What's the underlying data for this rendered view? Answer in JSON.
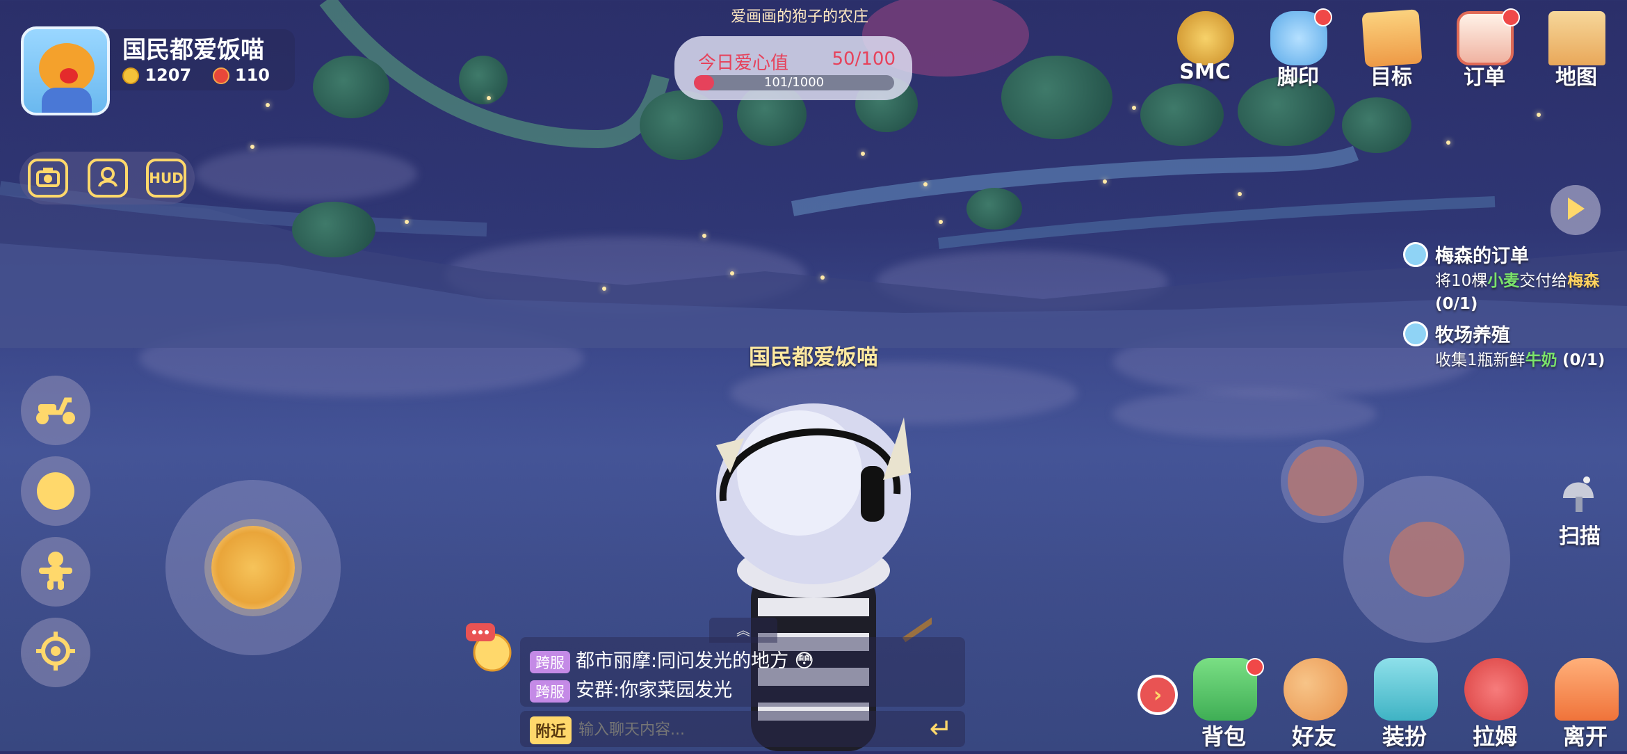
{
  "farm_title": "爱画画的狍子的农庄",
  "player": {
    "name": "国民都爱饭喵",
    "coins": "1207",
    "gems": "110"
  },
  "camera_buttons": [
    {
      "label": ""
    },
    {
      "label": ""
    },
    {
      "label": "HUD"
    }
  ],
  "love": {
    "label": "今日爱心值",
    "value_text": "50/100",
    "progress_text": "101/1000",
    "progress_fraction": 0.101
  },
  "top_menu": [
    {
      "label": "SMC",
      "icon": "smc-badge-icon",
      "color": "#e9a93a",
      "badge": false
    },
    {
      "label": "脚印",
      "icon": "paw-print-icon",
      "color": "#6db7f0",
      "badge": true
    },
    {
      "label": "目标",
      "icon": "target-card-icon",
      "color": "#f2a24a",
      "badge": false
    },
    {
      "label": "订单",
      "icon": "order-clipboard-icon",
      "color": "#ef7f6b",
      "badge": true
    },
    {
      "label": "地图",
      "icon": "castle-map-icon",
      "color": "#f5c36a",
      "badge": false
    }
  ],
  "tasks": [
    {
      "title": "梅森的订单",
      "desc_prefix": "将10棵",
      "desc_item": "小麦",
      "desc_mid": "交付给",
      "desc_target": "梅森",
      "desc_progress": "(0/1)"
    },
    {
      "title": "牧场养殖",
      "desc_prefix": "收集1瓶新鲜",
      "desc_item": "牛奶",
      "desc_mid": "",
      "desc_target": "",
      "desc_progress": "(0/1)"
    }
  ],
  "player_tag": "国民都爱饭喵",
  "scan_label": "扫描",
  "chat": {
    "expand_symbol": "︽",
    "messages": [
      {
        "tag": "跨服",
        "text": "都市丽摩:同问发光的地方 😳"
      },
      {
        "tag": "跨服",
        "text": "安群:你家菜园发光"
      }
    ],
    "channel": "附近",
    "placeholder": "输入聊天内容...",
    "send_symbol": "↵"
  },
  "bottom_toggle_symbol": "›",
  "bottom_menu": [
    {
      "label": "背包",
      "icon": "backpack-icon",
      "color": "#5fc86a",
      "badge": true
    },
    {
      "label": "好友",
      "icon": "friends-icon",
      "color": "#f3a35a",
      "badge": false
    },
    {
      "label": "装扮",
      "icon": "dress-up-icon",
      "color": "#5cc7d6",
      "badge": false
    },
    {
      "label": "拉姆",
      "icon": "lamu-pet-icon",
      "color": "#ef5a5a",
      "badge": false
    },
    {
      "label": "离开",
      "icon": "house-exit-icon",
      "color": "#f5874a",
      "badge": false
    }
  ]
}
